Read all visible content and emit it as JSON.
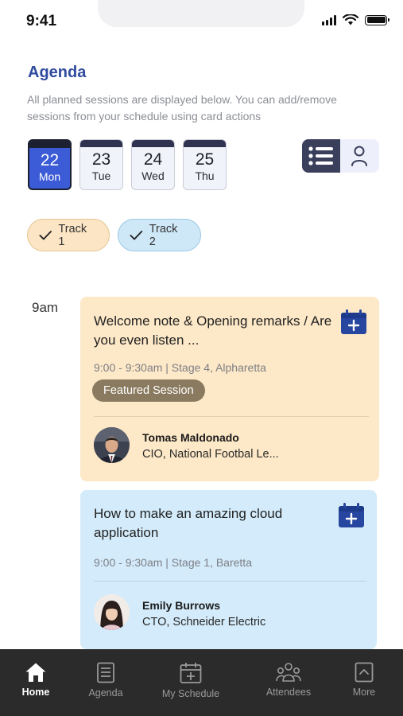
{
  "status_bar": {
    "time": "9:41",
    "icons": [
      "signal-icon",
      "wifi-icon",
      "battery-icon"
    ]
  },
  "header": {
    "title": "Agenda",
    "subtitle": "All planned sessions are displayed below. You can add/remove sessions from your schedule using card actions"
  },
  "dates": [
    {
      "day": "22",
      "weekday": "Mon",
      "selected": true
    },
    {
      "day": "23",
      "weekday": "Tue",
      "selected": false
    },
    {
      "day": "24",
      "weekday": "Wed",
      "selected": false
    },
    {
      "day": "25",
      "weekday": "Thu",
      "selected": false
    }
  ],
  "view_toggle": {
    "options": [
      "list-view-icon",
      "person-view-icon"
    ],
    "selected": "list-view-icon"
  },
  "tracks": [
    {
      "label": "Track 1",
      "checked": true,
      "color": "#fbe5c4"
    },
    {
      "label": "Track 2",
      "checked": true,
      "color": "#cfe8f8"
    }
  ],
  "schedule": {
    "time_slot": "9am",
    "sessions": [
      {
        "title": "Welcome note & Opening remarks / Are you even listen ...",
        "meta": "9:00 - 9:30am | Stage 4, Alpharetta",
        "badge": "Featured Session",
        "speaker": {
          "name": "Tomas Maldonado",
          "role": "CIO, National Footbal Le..."
        },
        "color": "#fde8c7"
      },
      {
        "title": "How to make an amazing cloud application",
        "meta": "9:00 - 9:30am | Stage 1, Baretta",
        "speaker": {
          "name": "Emily Burrows",
          "role": "CTO, Schneider Electric"
        },
        "color": "#d3ebfa"
      }
    ]
  },
  "bottom_nav": [
    {
      "label": "Home",
      "icon": "home-icon",
      "active": true
    },
    {
      "label": "Agenda",
      "icon": "agenda-icon",
      "active": false
    },
    {
      "label": "My Schedule",
      "icon": "calendar-plus-icon",
      "active": false
    },
    {
      "label": "Attendees",
      "icon": "people-icon",
      "active": false
    },
    {
      "label": "More",
      "icon": "chevron-up-icon",
      "active": false
    }
  ],
  "colors": {
    "accent": "#2f4a9e",
    "selected_date": "#3b5bd7",
    "nav_bg": "#2b2b2b"
  }
}
